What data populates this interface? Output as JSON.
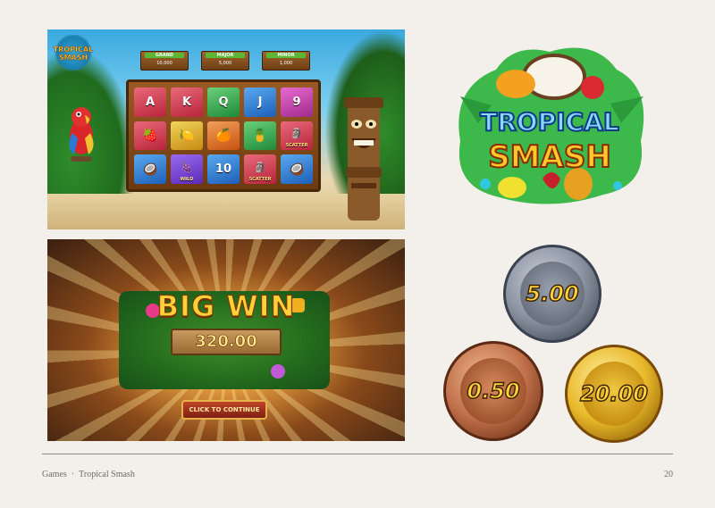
{
  "slot_game": {
    "logo_line1": "TROPICAL",
    "logo_line2": "SMASH",
    "jackpots": [
      {
        "name": "GRAND",
        "value": "10,000"
      },
      {
        "name": "MAJOR",
        "value": "5,000"
      },
      {
        "name": "MINOR",
        "value": "1,000"
      }
    ],
    "reels": [
      [
        {
          "label": "A",
          "color": "red"
        },
        {
          "label": "K",
          "color": "red"
        },
        {
          "label": "Q",
          "color": "green"
        },
        {
          "label": "J",
          "color": "blue"
        },
        {
          "label": "9",
          "color": "pink"
        }
      ],
      [
        {
          "icon": "strawberry-icon",
          "glyph": "🍓",
          "color": "red"
        },
        {
          "icon": "lemon-icon",
          "glyph": "🍋",
          "color": "yellow"
        },
        {
          "icon": "orange-icon",
          "glyph": "🍊",
          "color": "orange"
        },
        {
          "icon": "pineapple-icon",
          "glyph": "🍍",
          "color": "green"
        },
        {
          "icon": "tiki-scatter-icon",
          "glyph": "🗿",
          "label": "SCATTER",
          "color": "red"
        }
      ],
      [
        {
          "icon": "coconut-icon",
          "glyph": "🥥",
          "color": "blue"
        },
        {
          "icon": "wild-icon",
          "glyph": "🍇",
          "label": "WILD",
          "color": "purple"
        },
        {
          "label": "10",
          "color": "blue"
        },
        {
          "icon": "tiki-scatter-icon",
          "glyph": "🗿",
          "label": "SCATTER",
          "color": "red"
        },
        {
          "icon": "coconut-icon",
          "glyph": "🥥",
          "color": "blue"
        }
      ]
    ]
  },
  "big_win": {
    "title": "BIG WIN",
    "amount": "320.00",
    "button_label": "CLICK TO CONTINUE"
  },
  "brand_logo": {
    "line1": "TROPICAL",
    "line2": "SMASH"
  },
  "coins": {
    "silver": "5.00",
    "bronze": "0.50",
    "gold": "20.00"
  },
  "footer": {
    "section": "Games",
    "project": "Tropical Smash",
    "page_number": "20"
  },
  "colors": {
    "background": "#f3efeb",
    "footer_text": "#6e6a66",
    "rule": "#8c8782"
  }
}
